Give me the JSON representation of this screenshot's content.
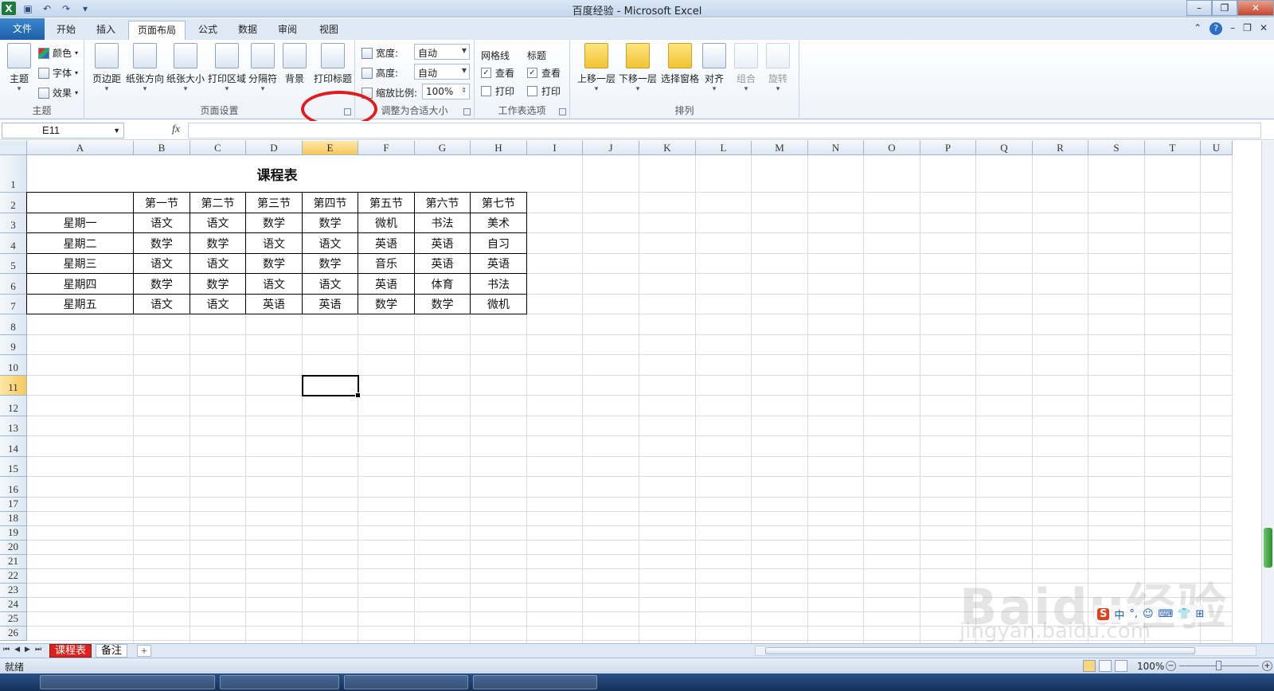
{
  "window": {
    "title": "百度经验 - Microsoft Excel"
  },
  "tabs": [
    {
      "label": "文件"
    },
    {
      "label": "开始"
    },
    {
      "label": "插入"
    },
    {
      "label": "页面布局"
    },
    {
      "label": "公式"
    },
    {
      "label": "数据"
    },
    {
      "label": "审阅"
    },
    {
      "label": "视图"
    }
  ],
  "ribbon": {
    "theme": {
      "themes": "主题",
      "colors": "颜色",
      "fonts": "字体",
      "effects": "效果",
      "group": "主题"
    },
    "page_setup": {
      "margins": "页边距",
      "orientation": "纸张方向",
      "size": "纸张大小",
      "print_area": "打印区域",
      "breaks": "分隔符",
      "background": "背景",
      "print_titles": "打印标题",
      "group": "页面设置"
    },
    "scale": {
      "width_label": "宽度:",
      "width_value": "自动",
      "height_label": "高度:",
      "height_value": "自动",
      "scale_label": "缩放比例:",
      "scale_value": "100%",
      "group": "调整为合适大小"
    },
    "sheet_options": {
      "gridlines": "网格线",
      "headings": "标题",
      "view": "查看",
      "print": "打印",
      "group": "工作表选项"
    },
    "arrange": {
      "bring_forward": "上移一层",
      "send_backward": "下移一层",
      "selection_pane": "选择窗格",
      "align": "对齐",
      "group_btn": "组合",
      "rotate": "旋转",
      "group": "排列"
    }
  },
  "formula_bar": {
    "name_box": "E11",
    "fx": "fx",
    "formula": ""
  },
  "columns": [
    "A",
    "B",
    "C",
    "D",
    "E",
    "F",
    "G",
    "H",
    "I",
    "J",
    "K",
    "L",
    "M",
    "N",
    "O",
    "P",
    "Q",
    "R",
    "S",
    "T",
    "U"
  ],
  "rows": [
    "1",
    "2",
    "3",
    "4",
    "5",
    "6",
    "7",
    "8",
    "9",
    "10",
    "11",
    "12",
    "13",
    "14",
    "15",
    "16",
    "17",
    "18",
    "19",
    "20",
    "21",
    "22",
    "23",
    "24",
    "25",
    "26"
  ],
  "sheet": {
    "title": "课程表",
    "headers": [
      "",
      "第一节",
      "第二节",
      "第三节",
      "第四节",
      "第五节",
      "第六节",
      "第七节"
    ],
    "rows": [
      [
        "星期一",
        "语文",
        "语文",
        "数学",
        "数学",
        "微机",
        "书法",
        "美术"
      ],
      [
        "星期二",
        "数学",
        "数学",
        "语文",
        "语文",
        "英语",
        "英语",
        "自习"
      ],
      [
        "星期三",
        "语文",
        "语文",
        "数学",
        "数学",
        "音乐",
        "英语",
        "英语"
      ],
      [
        "星期四",
        "数学",
        "数学",
        "语文",
        "语文",
        "英语",
        "体育",
        "书法"
      ],
      [
        "星期五",
        "语文",
        "语文",
        "英语",
        "英语",
        "数学",
        "数学",
        "微机"
      ]
    ]
  },
  "active_cell": "E11",
  "sheet_tabs": [
    {
      "label": "课程表",
      "active": true
    },
    {
      "label": "备注",
      "active": false
    }
  ],
  "status": {
    "ready": "就绪",
    "zoom": "100%"
  },
  "watermark": {
    "logo": "Baidu经验",
    "url": "jingyan.baidu.com"
  },
  "ime": {
    "items": [
      "中",
      "°,",
      "☺",
      "⌨",
      "👕",
      "⊞"
    ]
  },
  "colors": {
    "accent": "#1e5fa8",
    "sheet_tab_active": "#e0201d",
    "selected_header": "#f6c85a",
    "annotation": "#e01c1c"
  }
}
